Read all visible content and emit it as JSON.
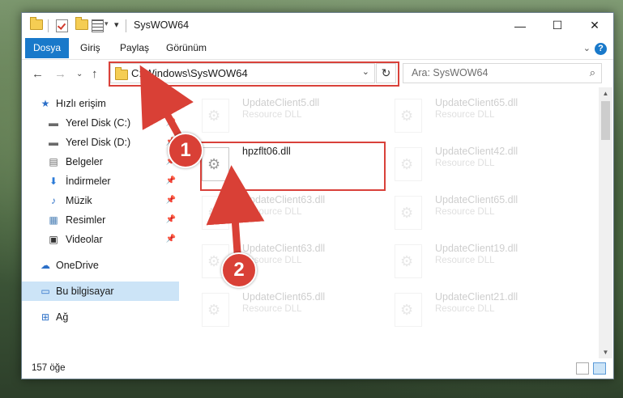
{
  "window": {
    "title": "SysWOW64",
    "minimize": "—",
    "maximize": "☐",
    "close": "✕"
  },
  "ribbon": {
    "tabs": [
      {
        "label": "Dosya",
        "active": true
      },
      {
        "label": "Giriş"
      },
      {
        "label": "Paylaş"
      },
      {
        "label": "Görünüm"
      }
    ],
    "expand": "⌄",
    "help": "?"
  },
  "nav": {
    "back": "←",
    "forward": "→",
    "recent": "⌄",
    "up": "↑",
    "address": "C:\\Windows\\SysWOW64",
    "dropdown": "⌄",
    "refresh": "↻",
    "search_placeholder": "Ara: SysWOW64",
    "search_icon": "⌕"
  },
  "sidebar": {
    "items": [
      {
        "label": "Hızlı erişim",
        "icon": "star-icon",
        "glyph": "★",
        "color": "#2b6fc8"
      },
      {
        "label": "Yerel Disk (C:)",
        "icon": "drive-icon",
        "glyph": "▬",
        "color": "#6a6a6a"
      },
      {
        "label": "Yerel Disk (D:)",
        "icon": "drive-icon",
        "glyph": "▬",
        "color": "#6a6a6a"
      },
      {
        "label": "Belgeler",
        "icon": "documents-icon",
        "glyph": "▤",
        "color": "#6a6a6a"
      },
      {
        "label": "İndirmeler",
        "icon": "download-icon",
        "glyph": "⬇",
        "color": "#2b7bd8"
      },
      {
        "label": "Müzik",
        "icon": "music-icon",
        "glyph": "♪",
        "color": "#2b6fc8"
      },
      {
        "label": "Resimler",
        "icon": "pictures-icon",
        "glyph": "▦",
        "color": "#4a7fb5"
      },
      {
        "label": "Videolar",
        "icon": "videos-icon",
        "glyph": "▣",
        "color": "#333333"
      },
      {
        "label": "OneDrive",
        "icon": "cloud-icon",
        "glyph": "☁",
        "color": "#2b6fc8"
      },
      {
        "label": "Bu bilgisayar",
        "icon": "computer-icon",
        "glyph": "▭",
        "color": "#2b6fc8"
      },
      {
        "label": "Ağ",
        "icon": "network-icon",
        "glyph": "⊞",
        "color": "#2b6fc8"
      }
    ],
    "pin": "📌"
  },
  "files": [
    {
      "name": "UpdateClient5.dll",
      "type": "Resource DLL",
      "faded": true
    },
    {
      "name": "UpdateClient65.dll",
      "type": "Resource DLL",
      "faded": true
    },
    {
      "name": "hpzflt06.dll",
      "type": "",
      "faded": false
    },
    {
      "name": "UpdateClient42.dll",
      "type": "Resource DLL",
      "faded": true
    },
    {
      "name": "UpdateClient63.dll",
      "type": "Resource DLL",
      "faded": true
    },
    {
      "name": "UpdateClient65.dll",
      "type": "Resource DLL",
      "faded": true
    },
    {
      "name": "UpdateClient63.dll",
      "type": "Resource DLL",
      "faded": true
    },
    {
      "name": "UpdateClient19.dll",
      "type": "Resource DLL",
      "faded": true
    },
    {
      "name": "UpdateClient65.dll",
      "type": "Resource DLL",
      "faded": true
    },
    {
      "name": "UpdateClient21.dll",
      "type": "Resource DLL",
      "faded": true
    }
  ],
  "status": {
    "count": "157 öğe"
  },
  "annotations": {
    "badge1": "1",
    "badge2": "2",
    "color": "#d94036"
  }
}
